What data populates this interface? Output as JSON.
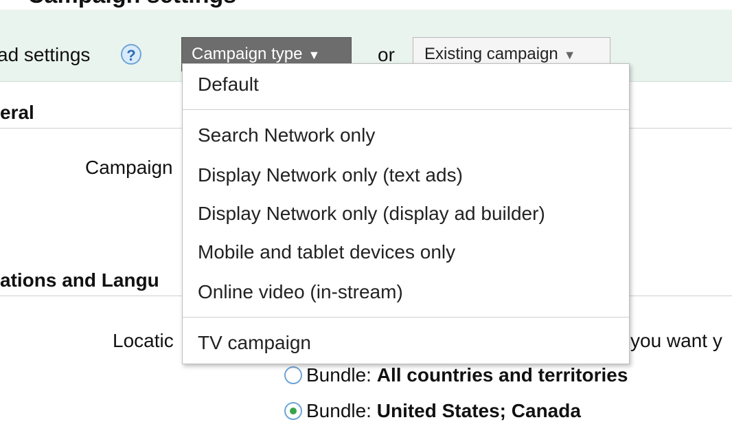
{
  "header": {
    "page_title_fragment": "Campaign settings"
  },
  "settings_bar": {
    "load_label": "ad settings",
    "help_icon": "?",
    "campaign_type_button": "Campaign type",
    "or_text": "or",
    "existing_campaign_button": "Existing campaign"
  },
  "sections": {
    "general": "eral",
    "campaign_label": "Campaign",
    "locations": "ations and Langu",
    "locations_label": "Locatic",
    "right_fragment": "you want y"
  },
  "radios": [
    {
      "prefix": "Bundle: ",
      "value": "All countries and territories",
      "selected": false
    },
    {
      "prefix": "Bundle: ",
      "value": "United States; Canada",
      "selected": true
    }
  ],
  "dropdown": {
    "items": [
      "Default",
      "Search Network only",
      "Display Network only (text ads)",
      "Display Network only (display ad builder)",
      "Mobile and tablet devices only",
      "Online video (in-stream)",
      "TV campaign"
    ]
  }
}
